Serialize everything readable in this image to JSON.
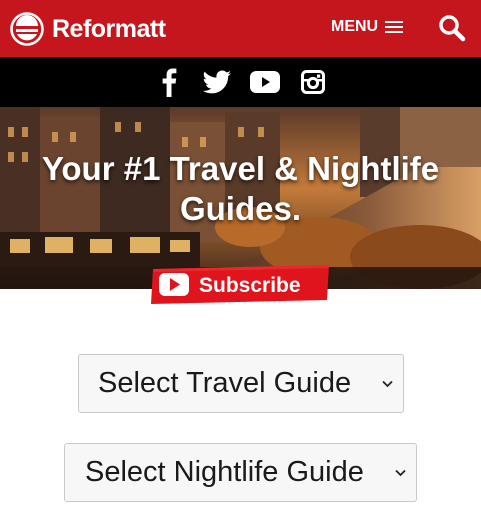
{
  "header": {
    "brand": "Reformatt",
    "menu_label": "MENU",
    "menu_icon": "hamburger-icon",
    "search_icon": "search-icon",
    "bg_color": "#c4161c"
  },
  "social": {
    "icons": [
      "facebook-icon",
      "twitter-icon",
      "youtube-icon",
      "instagram-icon"
    ]
  },
  "hero": {
    "title_line1": "Your #1 Travel & Nightlife",
    "title_line2": "Guides."
  },
  "subscribe": {
    "label": "Subscribe",
    "color": "#e0141c"
  },
  "selects": {
    "travel": "Select Travel Guide",
    "nightlife": "Select Nightlife Guide"
  }
}
